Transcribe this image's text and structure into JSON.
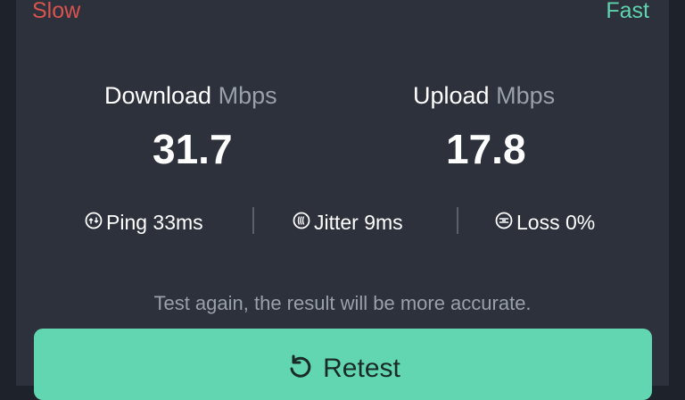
{
  "scale": {
    "slow_label": "Slow",
    "fast_label": "Fast"
  },
  "download": {
    "title": "Download",
    "unit": "Mbps",
    "value": "31.7"
  },
  "upload": {
    "title": "Upload",
    "unit": "Mbps",
    "value": "17.8"
  },
  "stats": {
    "ping": {
      "label": "Ping 33ms",
      "icon": "ping-icon"
    },
    "jitter": {
      "label": "Jitter 9ms",
      "icon": "jitter-icon"
    },
    "loss": {
      "label": "Loss 0%",
      "icon": "loss-icon"
    }
  },
  "hint": "Test again, the result will be more accurate.",
  "retest": {
    "label": "Retest",
    "icon": "retest-icon"
  },
  "colors": {
    "background": "#1e222a",
    "panel": "#2c313c",
    "slow": "#d9534f",
    "fast": "#5fd3ad",
    "button": "#62d6b1",
    "muted_text": "#9aa0aa"
  }
}
